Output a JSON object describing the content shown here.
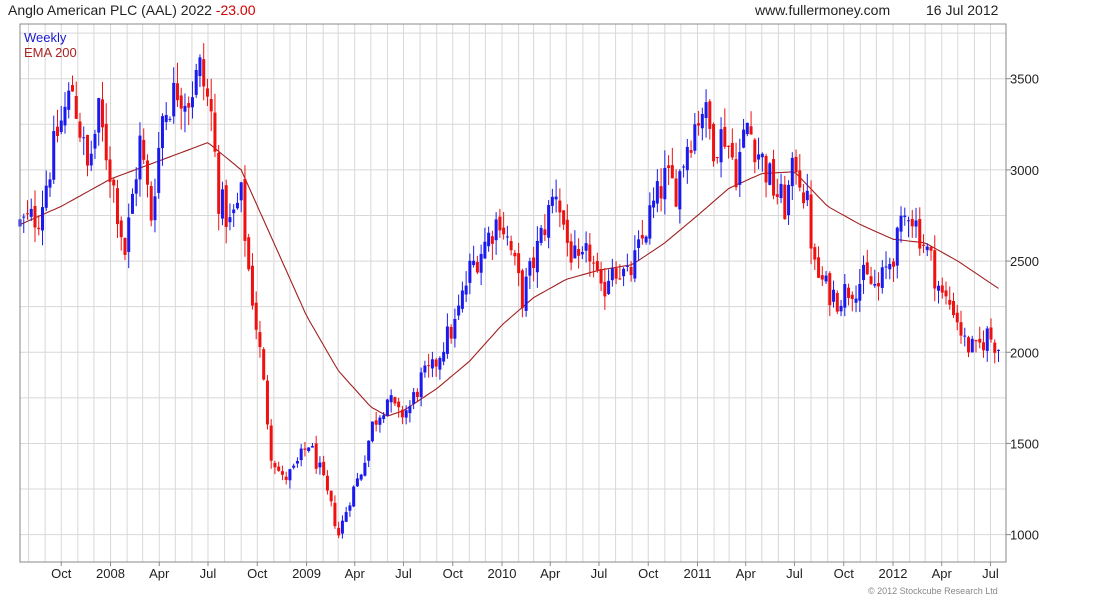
{
  "header": {
    "title_main": "Anglo American PLC (AAL) 2022",
    "title_change": "-23.00",
    "site": "www.fullermoney.com",
    "date": "16 Jul 2012"
  },
  "legend": {
    "weekly": "Weekly",
    "ema": "EMA 200"
  },
  "footer": {
    "copyright": "© 2012 Stockcube Research Ltd"
  },
  "colors": {
    "up": "#1a1aee",
    "down": "#ee1111",
    "ema": "#a02020",
    "grid": "#d8d8d8",
    "frame": "#888888"
  },
  "chart_data": {
    "type": "candlestick",
    "yticks": [
      1000,
      1500,
      2000,
      2500,
      3000,
      3500
    ],
    "ylim": [
      850,
      3800
    ],
    "xlim": [
      "2007-07-16",
      "2012-07-30"
    ],
    "xticks": [
      {
        "label": "Oct",
        "date": "2007-10-01"
      },
      {
        "label": "2008",
        "date": "2008-01-01"
      },
      {
        "label": "Apr",
        "date": "2008-04-01"
      },
      {
        "label": "Jul",
        "date": "2008-07-01"
      },
      {
        "label": "Oct",
        "date": "2008-10-01"
      },
      {
        "label": "2009",
        "date": "2009-01-01"
      },
      {
        "label": "Apr",
        "date": "2009-04-01"
      },
      {
        "label": "Jul",
        "date": "2009-07-01"
      },
      {
        "label": "Oct",
        "date": "2009-10-01"
      },
      {
        "label": "2010",
        "date": "2010-01-01"
      },
      {
        "label": "Apr",
        "date": "2010-04-01"
      },
      {
        "label": "Jul",
        "date": "2010-07-01"
      },
      {
        "label": "Oct",
        "date": "2010-10-01"
      },
      {
        "label": "2011",
        "date": "2011-01-01"
      },
      {
        "label": "Apr",
        "date": "2011-04-01"
      },
      {
        "label": "Jul",
        "date": "2011-07-01"
      },
      {
        "label": "Oct",
        "date": "2011-10-01"
      },
      {
        "label": "2012",
        "date": "2012-01-01"
      },
      {
        "label": "Apr",
        "date": "2012-04-01"
      },
      {
        "label": "Jul",
        "date": "2012-07-01"
      }
    ],
    "close_anchors": [
      [
        "2007-07-16",
        2700
      ],
      [
        "2007-08-20",
        2750
      ],
      [
        "2007-09-24",
        3200
      ],
      [
        "2007-10-22",
        3450
      ],
      [
        "2007-11-19",
        3000
      ],
      [
        "2007-12-10",
        3300
      ],
      [
        "2008-01-07",
        2900
      ],
      [
        "2008-01-28",
        2550
      ],
      [
        "2008-02-25",
        3150
      ],
      [
        "2008-03-17",
        2750
      ],
      [
        "2008-04-07",
        3300
      ],
      [
        "2008-05-05",
        3450
      ],
      [
        "2008-05-26",
        3400
      ],
      [
        "2008-06-16",
        3550
      ],
      [
        "2008-07-07",
        3300
      ],
      [
        "2008-07-21",
        2850
      ],
      [
        "2008-08-11",
        2700
      ],
      [
        "2008-09-01",
        2850
      ],
      [
        "2008-09-15",
        2450
      ],
      [
        "2008-10-06",
        2000
      ],
      [
        "2008-10-27",
        1450
      ],
      [
        "2008-11-17",
        1300
      ],
      [
        "2008-12-08",
        1350
      ],
      [
        "2009-01-05",
        1500
      ],
      [
        "2009-01-26",
        1350
      ],
      [
        "2009-02-16",
        1150
      ],
      [
        "2009-03-02",
        1000
      ],
      [
        "2009-03-23",
        1200
      ],
      [
        "2009-04-13",
        1350
      ],
      [
        "2009-05-04",
        1600
      ],
      [
        "2009-06-01",
        1750
      ],
      [
        "2009-06-22",
        1650
      ],
      [
        "2009-07-13",
        1700
      ],
      [
        "2009-08-03",
        1850
      ],
      [
        "2009-08-24",
        1900
      ],
      [
        "2009-09-14",
        2050
      ],
      [
        "2009-10-05",
        2150
      ],
      [
        "2009-11-02",
        2450
      ],
      [
        "2009-11-30",
        2600
      ],
      [
        "2009-12-28",
        2750
      ],
      [
        "2010-01-18",
        2550
      ],
      [
        "2010-02-08",
        2300
      ],
      [
        "2010-03-01",
        2500
      ],
      [
        "2010-03-22",
        2700
      ],
      [
        "2010-04-12",
        2900
      ],
      [
        "2010-05-03",
        2600
      ],
      [
        "2010-05-24",
        2450
      ],
      [
        "2010-06-14",
        2550
      ],
      [
        "2010-07-05",
        2300
      ],
      [
        "2010-07-26",
        2500
      ],
      [
        "2010-08-23",
        2400
      ],
      [
        "2010-09-13",
        2550
      ],
      [
        "2010-10-04",
        2750
      ],
      [
        "2010-11-01",
        2950
      ],
      [
        "2010-11-22",
        2900
      ],
      [
        "2010-12-13",
        3150
      ],
      [
        "2011-01-10",
        3350
      ],
      [
        "2011-01-31",
        3150
      ],
      [
        "2011-02-21",
        3200
      ],
      [
        "2011-03-14",
        3000
      ],
      [
        "2011-04-04",
        3250
      ],
      [
        "2011-04-25",
        3100
      ],
      [
        "2011-05-23",
        2900
      ],
      [
        "2011-06-13",
        2800
      ],
      [
        "2011-07-04",
        3050
      ],
      [
        "2011-07-25",
        2800
      ],
      [
        "2011-08-08",
        2450
      ],
      [
        "2011-08-29",
        2350
      ],
      [
        "2011-09-19",
        2300
      ],
      [
        "2011-10-10",
        2350
      ],
      [
        "2011-11-07",
        2400
      ],
      [
        "2011-12-05",
        2350
      ],
      [
        "2012-01-09",
        2600
      ],
      [
        "2012-01-30",
        2800
      ],
      [
        "2012-02-20",
        2650
      ],
      [
        "2012-03-12",
        2500
      ],
      [
        "2012-04-02",
        2300
      ],
      [
        "2012-04-23",
        2250
      ],
      [
        "2012-05-14",
        2050
      ],
      [
        "2012-06-04",
        2000
      ],
      [
        "2012-06-25",
        2100
      ],
      [
        "2012-07-16",
        2030
      ]
    ],
    "ema_anchors": [
      [
        "2007-07-16",
        2700
      ],
      [
        "2007-10-01",
        2800
      ],
      [
        "2008-01-01",
        2950
      ],
      [
        "2008-04-01",
        3050
      ],
      [
        "2008-07-01",
        3150
      ],
      [
        "2008-09-01",
        3000
      ],
      [
        "2008-11-01",
        2600
      ],
      [
        "2009-01-01",
        2200
      ],
      [
        "2009-03-01",
        1900
      ],
      [
        "2009-05-01",
        1700
      ],
      [
        "2009-06-01",
        1650
      ],
      [
        "2009-07-01",
        1680
      ],
      [
        "2009-09-01",
        1800
      ],
      [
        "2009-11-01",
        1950
      ],
      [
        "2010-01-01",
        2150
      ],
      [
        "2010-03-01",
        2300
      ],
      [
        "2010-05-01",
        2400
      ],
      [
        "2010-07-01",
        2450
      ],
      [
        "2010-09-01",
        2480
      ],
      [
        "2010-11-01",
        2600
      ],
      [
        "2011-01-01",
        2750
      ],
      [
        "2011-03-01",
        2900
      ],
      [
        "2011-05-01",
        2980
      ],
      [
        "2011-07-01",
        2990
      ],
      [
        "2011-09-01",
        2800
      ],
      [
        "2011-11-01",
        2700
      ],
      [
        "2012-01-01",
        2620
      ],
      [
        "2012-03-01",
        2600
      ],
      [
        "2012-05-01",
        2500
      ],
      [
        "2012-07-16",
        2350
      ]
    ]
  }
}
